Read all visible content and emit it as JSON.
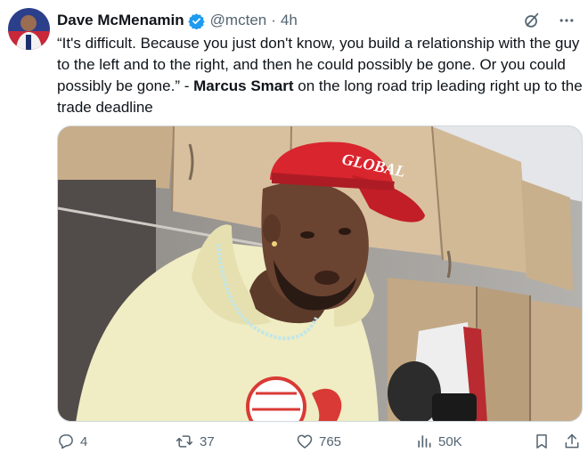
{
  "tweet": {
    "author": {
      "display_name": "Dave McMenamin",
      "handle": "@mcten",
      "verified": true
    },
    "time_ago": "4h",
    "text": {
      "quote": "“It's difficult. Because you just don't know, you build a relationship with the guy to the left and to the right, and then he could possibly be gone. Or you could possibly be gone.”",
      "dash": " - ",
      "name": "Marcus Smart",
      "rest": " on the long road trip leading right up to the trade deadline"
    },
    "media": {
      "cap_text": "GLOBAL"
    },
    "stats": {
      "replies": "4",
      "reposts": "37",
      "likes": "765",
      "views": "50K"
    }
  },
  "icons": {
    "verified": "verified-badge-icon",
    "grok": "grok-icon",
    "more": "more-options-icon",
    "reply": "reply-icon",
    "repost": "repost-icon",
    "like": "like-icon",
    "views": "views-icon",
    "bookmark": "bookmark-icon",
    "share": "share-icon"
  },
  "colors": {
    "verified": "#1d9bf0",
    "text": "#0f1419",
    "secondary": "#536471"
  }
}
